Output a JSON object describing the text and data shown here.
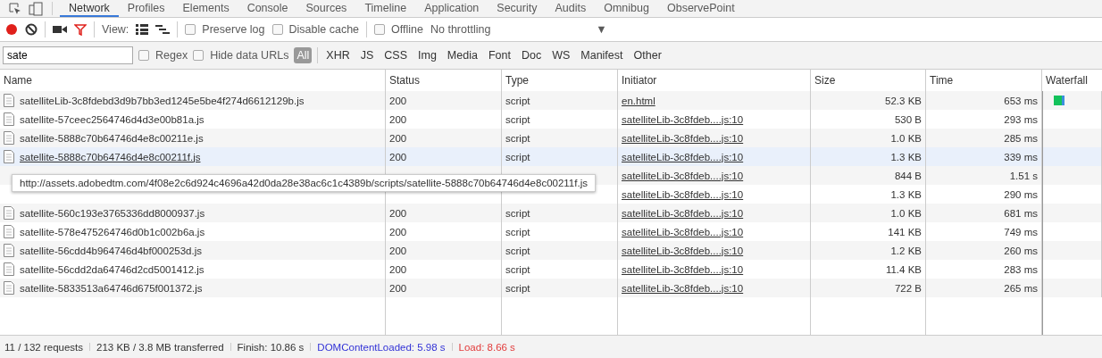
{
  "tabs": [
    {
      "label": "Network",
      "selected": true
    },
    {
      "label": "Profiles",
      "selected": false
    },
    {
      "label": "Elements",
      "selected": false
    },
    {
      "label": "Console",
      "selected": false
    },
    {
      "label": "Sources",
      "selected": false
    },
    {
      "label": "Timeline",
      "selected": false
    },
    {
      "label": "Application",
      "selected": false
    },
    {
      "label": "Security",
      "selected": false
    },
    {
      "label": "Audits",
      "selected": false
    },
    {
      "label": "Omnibug",
      "selected": false
    },
    {
      "label": "ObservePoint",
      "selected": false
    }
  ],
  "toolbar": {
    "recording": true,
    "filter_on": true,
    "view_label": "View:",
    "large_rows": true,
    "checkboxes": [
      {
        "label": "Preserve log",
        "checked": false
      },
      {
        "label": "Disable cache",
        "checked": false
      },
      {
        "label": "Offline",
        "checked": false
      }
    ],
    "throttling": "No throttling",
    "throttling_caret": "▼"
  },
  "filter": {
    "value": "sate",
    "checkboxes": [
      {
        "label": "Regex",
        "checked": false
      },
      {
        "label": "Hide data URLs",
        "checked": false
      }
    ],
    "types": [
      {
        "label": "All",
        "selected": true
      },
      {
        "label": "XHR",
        "selected": false
      },
      {
        "label": "JS",
        "selected": false
      },
      {
        "label": "CSS",
        "selected": false
      },
      {
        "label": "Img",
        "selected": false
      },
      {
        "label": "Media",
        "selected": false
      },
      {
        "label": "Font",
        "selected": false
      },
      {
        "label": "Doc",
        "selected": false
      },
      {
        "label": "WS",
        "selected": false
      },
      {
        "label": "Manifest",
        "selected": false
      },
      {
        "label": "Other",
        "selected": false
      }
    ]
  },
  "table": {
    "columns": [
      "Name",
      "Status",
      "Type",
      "Initiator",
      "Size",
      "Time",
      "Waterfall"
    ],
    "rows": [
      {
        "name": "satelliteLib-3c8fdebd3d9b7bb3ed1245e5be4f274d6612129b.js",
        "status": "200",
        "type": "script",
        "initiator": "en.html",
        "size": "52.3 KB",
        "time": "653 ms",
        "waterfall_bar": true,
        "selected": false
      },
      {
        "name": "satellite-57ceec2564746d4d3e00b81a.js",
        "status": "200",
        "type": "script",
        "initiator": "satelliteLib-3c8fdeb....js:10",
        "size": "530 B",
        "time": "293 ms",
        "waterfall_bar": false,
        "selected": false
      },
      {
        "name": "satellite-5888c70b64746d4e8c00211e.js",
        "status": "200",
        "type": "script",
        "initiator": "satelliteLib-3c8fdeb....js:10",
        "size": "1.0 KB",
        "time": "285 ms",
        "waterfall_bar": false,
        "selected": false
      },
      {
        "name": "satellite-5888c70b64746d4e8c00211f.js",
        "status": "200",
        "type": "script",
        "initiator": "satelliteLib-3c8fdeb....js:10",
        "size": "1.3 KB",
        "time": "339 ms",
        "waterfall_bar": false,
        "selected": true
      },
      {
        "initiator": "satelliteLib-3c8fdeb....js:10",
        "size": "844 B",
        "time": "1.51 s",
        "waterfall_bar": false,
        "selected": false
      },
      {
        "initiator": "satelliteLib-3c8fdeb....js:10",
        "size": "1.3 KB",
        "time": "290 ms",
        "waterfall_bar": false,
        "selected": false
      },
      {
        "name": "satellite-560c193e3765336dd8000937.js",
        "status": "200",
        "type": "script",
        "initiator": "satelliteLib-3c8fdeb....js:10",
        "size": "1.0 KB",
        "time": "681 ms",
        "waterfall_bar": false,
        "selected": false
      },
      {
        "name": "satellite-578e475264746d0b1c002b6a.js",
        "status": "200",
        "type": "script",
        "initiator": "satelliteLib-3c8fdeb....js:10",
        "size": "141 KB",
        "time": "749 ms",
        "waterfall_bar": false,
        "selected": false
      },
      {
        "name": "satellite-56cdd4b964746d4bf000253d.js",
        "status": "200",
        "type": "script",
        "initiator": "satelliteLib-3c8fdeb....js:10",
        "size": "1.2 KB",
        "time": "260 ms",
        "waterfall_bar": false,
        "selected": false
      },
      {
        "name": "satellite-56cdd2da64746d2cd5001412.js",
        "status": "200",
        "type": "script",
        "initiator": "satelliteLib-3c8fdeb....js:10",
        "size": "11.4 KB",
        "time": "283 ms",
        "waterfall_bar": false,
        "selected": false
      },
      {
        "name": "satellite-5833513a64746d675f001372.js",
        "status": "200",
        "type": "script",
        "initiator": "satelliteLib-3c8fdeb....js:10",
        "size": "722 B",
        "time": "265 ms",
        "waterfall_bar": false,
        "selected": false
      }
    ],
    "tooltip": "http://assets.adobedtm.com/4f08e2c6d924c4696a42d0da28e38ac6c1c4389b/scripts/satellite-5888c70b64746d4e8c00211f.js"
  },
  "status_bar": [
    {
      "kind": "plain",
      "text": "11 / 132 requests"
    },
    {
      "kind": "plain",
      "text": "213 KB / 3.8 MB transferred"
    },
    {
      "kind": "plain",
      "text": "Finish: 10.86 s"
    },
    {
      "kind": "dom",
      "text": "DOMContentLoaded: 5.98 s"
    },
    {
      "kind": "load",
      "text": "Load: 8.66 s"
    }
  ]
}
